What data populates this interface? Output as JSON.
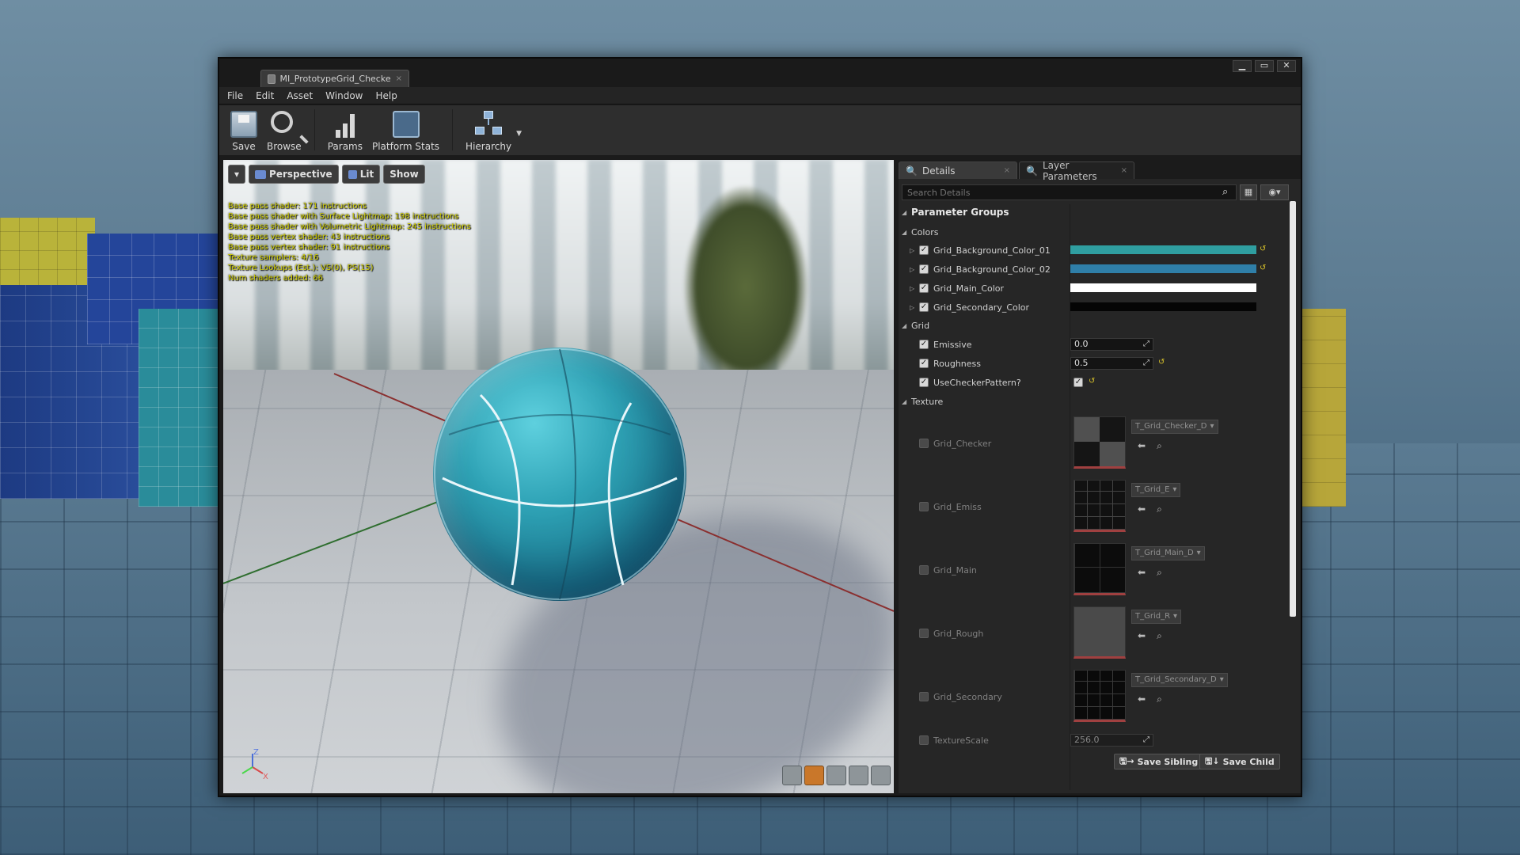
{
  "window": {
    "tab_title": "MI_PrototypeGrid_Checke",
    "tab_close": "×",
    "controls": {
      "minimize": "▁",
      "maximize": "▭",
      "close": "✕"
    }
  },
  "menu": [
    "File",
    "Edit",
    "Asset",
    "Window",
    "Help"
  ],
  "toolbar": {
    "save": "Save",
    "browse": "Browse",
    "params": "Params",
    "platform_stats": "Platform Stats",
    "hierarchy": "Hierarchy"
  },
  "viewport": {
    "view_mode": "Perspective",
    "lighting": "Lit",
    "show": "Show",
    "stats": [
      "Base pass shader: 171 instructions",
      "Base pass shader with Surface Lightmap: 198 instructions",
      "Base pass shader with Volumetric Lightmap: 245 instructions",
      "Base pass vertex shader: 43 instructions",
      "Base pass vertex shader: 91 instructions",
      "Texture samplers: 4/16",
      "Texture Lookups (Est.): VS(0), PS(15)",
      "Num shaders added: 66"
    ],
    "gizmo": {
      "z": "Z",
      "x": "X"
    }
  },
  "details": {
    "tab_details": "Details",
    "tab_layer": "Layer Parameters",
    "search_placeholder": "Search Details",
    "group_title": "Parameter Groups",
    "colors_header": "Colors",
    "colors": [
      {
        "name": "Grid_Background_Color_01",
        "color": "#2f9ea0"
      },
      {
        "name": "Grid_Background_Color_02",
        "color": "#2f7fa8"
      },
      {
        "name": "Grid_Main_Color",
        "color": "#ffffff"
      },
      {
        "name": "Grid_Secondary_Color",
        "color": "#050505"
      }
    ],
    "grid_header": "Grid",
    "emissive": {
      "name": "Emissive",
      "value": "0.0"
    },
    "roughness": {
      "name": "Roughness",
      "value": "0.5"
    },
    "checker": {
      "name": "UseCheckerPattern?"
    },
    "texture_header": "Texture",
    "textures": [
      {
        "name": "Grid_Checker",
        "asset": "T_Grid_Checker_D"
      },
      {
        "name": "Grid_Emiss",
        "asset": "T_Grid_E"
      },
      {
        "name": "Grid_Main",
        "asset": "T_Grid_Main_D"
      },
      {
        "name": "Grid_Rough",
        "asset": "T_Grid_R"
      },
      {
        "name": "Grid_Secondary",
        "asset": "T_Grid_Secondary_D"
      }
    ],
    "texture_scale": {
      "name": "TextureScale",
      "value": "256.0"
    },
    "save_sibling": "Save Sibling",
    "save_child": "Save Child"
  }
}
